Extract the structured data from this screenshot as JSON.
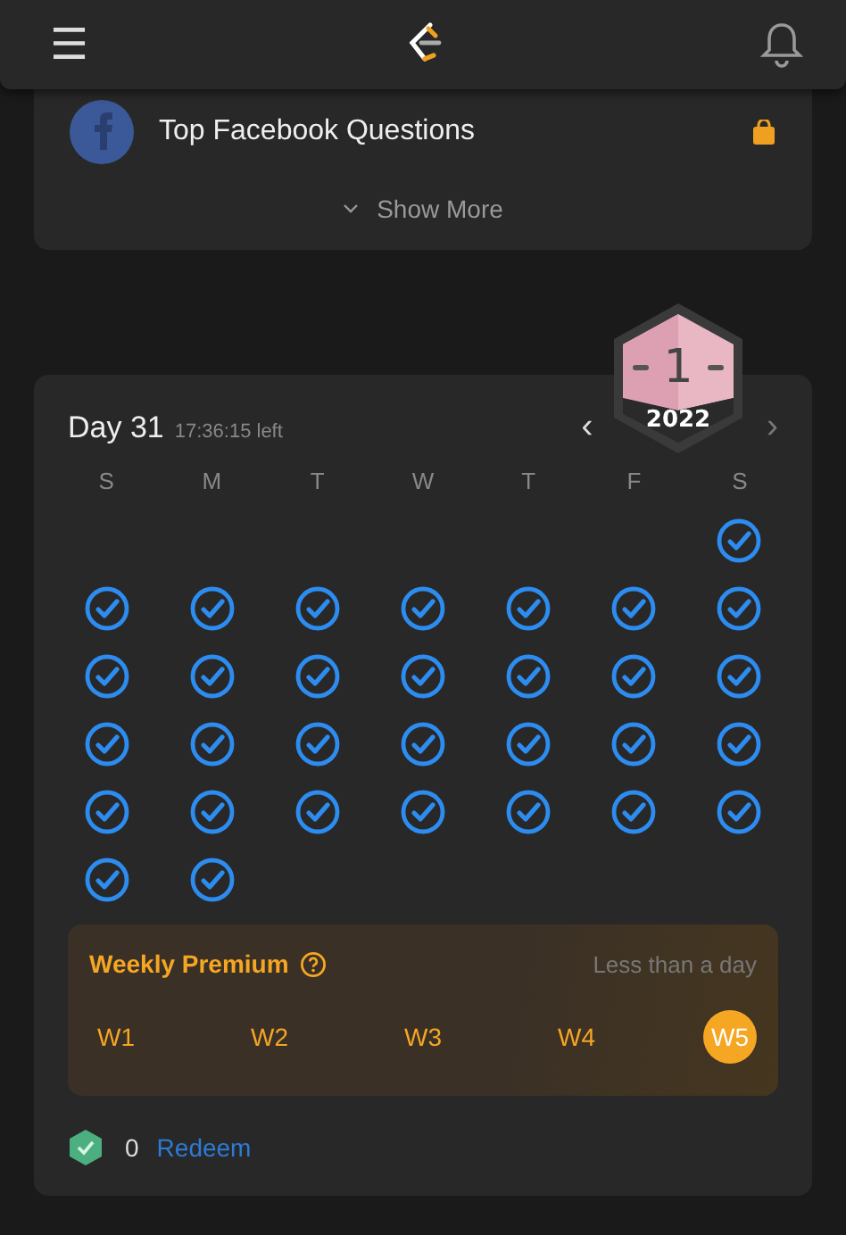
{
  "header": {
    "menu": "☰"
  },
  "question_list": {
    "item": "Top Facebook Questions",
    "show_more": "Show More"
  },
  "checkin": {
    "day": "Day 31",
    "time_left": "17:36:15 left",
    "badge_number": "1",
    "badge_year": "2022",
    "prev": "‹",
    "next": "›",
    "weekdays": [
      "S",
      "M",
      "T",
      "W",
      "T",
      "F",
      "S"
    ],
    "weeks": [
      [
        {
          "kind": "empty"
        },
        {
          "kind": "empty"
        },
        {
          "kind": "empty"
        },
        {
          "kind": "empty"
        },
        {
          "kind": "empty"
        },
        {
          "kind": "empty"
        },
        {
          "kind": "done"
        }
      ],
      [
        {
          "kind": "done"
        },
        {
          "kind": "done"
        },
        {
          "kind": "done"
        },
        {
          "kind": "done"
        },
        {
          "kind": "done"
        },
        {
          "kind": "done"
        },
        {
          "kind": "done"
        }
      ],
      [
        {
          "kind": "done"
        },
        {
          "kind": "done"
        },
        {
          "kind": "done"
        },
        {
          "kind": "done"
        },
        {
          "kind": "done"
        },
        {
          "kind": "done"
        },
        {
          "kind": "done"
        }
      ],
      [
        {
          "kind": "done"
        },
        {
          "kind": "done"
        },
        {
          "kind": "done"
        },
        {
          "kind": "done"
        },
        {
          "kind": "done"
        },
        {
          "kind": "done"
        },
        {
          "kind": "done"
        }
      ],
      [
        {
          "kind": "done"
        },
        {
          "kind": "done"
        },
        {
          "kind": "done"
        },
        {
          "kind": "done"
        },
        {
          "kind": "done"
        },
        {
          "kind": "done"
        },
        {
          "kind": "done"
        }
      ],
      [
        {
          "kind": "done"
        },
        {
          "kind": "done"
        },
        {
          "kind": "empty"
        },
        {
          "kind": "empty"
        },
        {
          "kind": "empty"
        },
        {
          "kind": "empty"
        },
        {
          "kind": "empty"
        }
      ]
    ],
    "premium": {
      "title": "Weekly Premium",
      "remaining": "Less than a day",
      "weeks": [
        {
          "label": "W1",
          "selected": false
        },
        {
          "label": "W2",
          "selected": false
        },
        {
          "label": "W3",
          "selected": false
        },
        {
          "label": "W4",
          "selected": false
        },
        {
          "label": "W5",
          "selected": true
        }
      ]
    },
    "coins": "0",
    "redeem": "Redeem"
  }
}
